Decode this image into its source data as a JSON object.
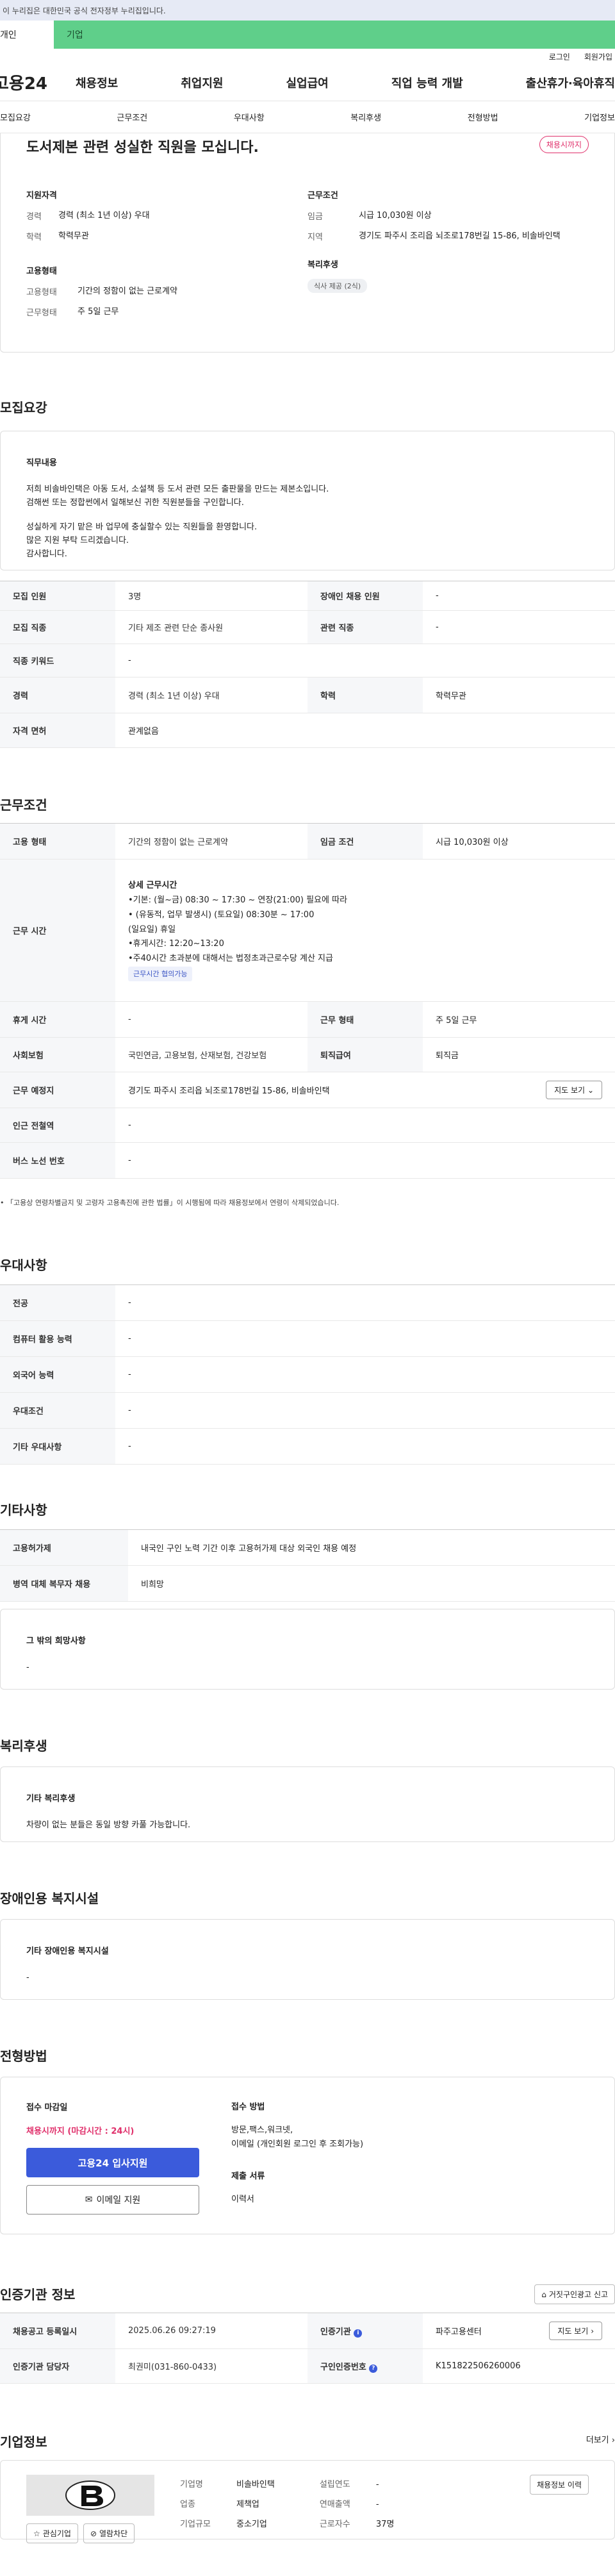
{
  "gov_banner": {
    "text": "이 누리집은 대한민국 공식 전자정부 누리집입니다."
  },
  "site_tabs": {
    "personal": "개인",
    "company": "기업"
  },
  "util": {
    "login": "로그인",
    "signup": "회원가입"
  },
  "logo": "고용24",
  "gnb": [
    "채용정보",
    "취업지원",
    "실업급여",
    "직업 능력 개발",
    "출산휴가·육아휴직"
  ],
  "anchor_nav": [
    "모집요강",
    "근무조건",
    "우대사항",
    "복리후생",
    "전형방법",
    "기업정보"
  ],
  "summary": {
    "title": "도서제본 관련 성실한 직원을 모십니다.",
    "status": "채용시까지",
    "qual_heading": "지원자격",
    "qual": [
      {
        "k": "경력",
        "v": "경력 (최소 1년 이상) 우대"
      },
      {
        "k": "학력",
        "v": "학력무관"
      }
    ],
    "emp_heading": "고용형태",
    "emp": [
      {
        "k": "고용형태",
        "v": "기간의 정함이 없는 근로계약"
      },
      {
        "k": "근무형태",
        "v": "주 5일 근무"
      }
    ],
    "cond_heading": "근무조건",
    "cond": [
      {
        "k": "임금",
        "v": "시급 10,030원 이상"
      },
      {
        "k": "지역",
        "v": "경기도 파주시 조리읍 뇌조로178번길 15-86, 비솔바인택"
      }
    ],
    "welfare_heading": "복리후생",
    "welfare_pill": "식사 제공 (2식)"
  },
  "recruit": {
    "heading": "모집요강",
    "duty_heading": "직무내용",
    "duty_lines": [
      "저희 비솔바인택은 아동 도서, 소설책 등 도서 관련 모든 출판물을 만드는 제본소입니다.",
      "검해썬 또는 정합썬에서 일해보신 귀한 직원분들을 구인합니다.",
      "",
      "성실하게 자기 맡은 바 업무에 충실할수 있는 직원들을 환영합니다.",
      "많은 지원 부탁 드리겠습니다.",
      "감사합니다."
    ],
    "rows": [
      {
        "k1": "모집 인원",
        "v1": "3명",
        "k2": "장애인 채용 인원",
        "v2": "-"
      },
      {
        "k1": "모집 직종",
        "v1": "기타 제조 관련 단순 종사원",
        "k2": "관련 직종",
        "v2": "-"
      },
      {
        "k1": "직종 키워드",
        "v1": "-"
      },
      {
        "k1": "경력",
        "v1": "경력 (최소 1년 이상) 우대",
        "k2": "학력",
        "v2": "학력무관"
      },
      {
        "k1": "자격 면허",
        "v1": "관계없음"
      }
    ]
  },
  "work": {
    "heading": "근무조건",
    "row1": {
      "k1": "고용 형태",
      "v1": "기간의 정함이 없는 근로계약",
      "k2": "임금 조건",
      "v2": "시급 10,030원 이상"
    },
    "hours_label": "근무 시간",
    "hours_title": "상세 근무시간",
    "hours_lines": [
      "•기본: (월~금) 08:30 ~ 17:30 ~ 연장(21:00) 필요에 따라",
      "• (유동적, 업무 발생시) (토요일) 08:30분 ~ 17:00",
      "(일요일) 휴일",
      "•휴게시간: 12:20~13:20",
      "•주40시간 초과분에 대해서는 법정초과근로수당 계산 지급"
    ],
    "hours_badge": "근무시간 협의가능",
    "row3": {
      "k1": "휴게 시간",
      "v1": "-",
      "k2": "근무 형태",
      "v2": "주 5일 근무"
    },
    "row4": {
      "k1": "사회보험",
      "v1": "국민연금, 고용보험, 산재보험, 건강보험",
      "k2": "퇴직급여",
      "v2": "퇴직금"
    },
    "row5": {
      "k1": "근무 예정지",
      "v1": "경기도 파주시 조리읍 뇌조로178번길 15-86, 비솔바인택",
      "btn": "지도 보기"
    },
    "row6": {
      "k1": "인근 전철역",
      "v1": "-"
    },
    "row7": {
      "k1": "버스 노선 번호",
      "v1": "-"
    },
    "note": "「고용상 연령차별금지 및 고령자 고용촉진에 관한 법률」이 시행됨에 따라 채용정보에서 연령이 삭제되었습니다."
  },
  "pref": {
    "heading": "우대사항",
    "rows": [
      {
        "k": "전공",
        "v": "-"
      },
      {
        "k": "컴퓨터 활용 능력",
        "v": "-"
      },
      {
        "k": "외국어 능력",
        "v": "-"
      },
      {
        "k": "우대조건",
        "v": "-"
      },
      {
        "k": "기타 우대사항",
        "v": "-"
      }
    ]
  },
  "etc": {
    "heading": "기타사항",
    "rows": [
      {
        "k": "고용허가제",
        "v": "내국인 구인 노력 기간 이후 고용허가제 대상 외국인 채용 예정"
      },
      {
        "k": "병역 대체 복무자 채용",
        "v": "비희망"
      }
    ],
    "other_heading": "그 밖의 희망사항",
    "other_value": "-"
  },
  "welfare": {
    "heading": "복리후생",
    "box_heading": "기타 복리후생",
    "box_text": "차량이 없는 분들은 동일 방향 카풀 가능합니다."
  },
  "disabled": {
    "heading": "장애인용 복지시설",
    "box_heading": "기타 장애인용 복지시설",
    "box_text": "-"
  },
  "selection": {
    "heading": "전형방법",
    "deadline_heading": "접수 마감일",
    "deadline": "채용시까지 (마감시간 : 24시)",
    "apply_button": "고용24 입사지원",
    "mail_button": "이메일 지원",
    "method_heading": "접수 방법",
    "method_lines": [
      "방문,팩스,워크넷,",
      "이메일 (개인회원 로그인 후 조회가능)"
    ],
    "docs_heading": "제출 서류",
    "docs": "이력서"
  },
  "agency": {
    "heading": "인증기관 정보",
    "report_button": "거짓구인광고 신고",
    "row1": {
      "k1": "채용공고 등록일시",
      "v1": "2025.06.26 09:27:19",
      "k2": "인증기관",
      "v2": "파주고용센터",
      "btn": "지도 보기"
    },
    "row2": {
      "k1": "인증기관 담당자",
      "v1": "최권미(031-860-0433)",
      "k2": "구인인증번호",
      "v2": "K151822506260006"
    }
  },
  "company": {
    "heading": "기업정보",
    "more": "더보기",
    "fav_button": "관심기업",
    "block_button": "열람차단",
    "fields": [
      {
        "k": "기업명",
        "v": "비솔바인택"
      },
      {
        "k": "업종",
        "v": "제책업"
      },
      {
        "k": "기업규모",
        "v": "중소기업"
      }
    ],
    "fields2": [
      {
        "k": "설립연도",
        "v": "-"
      },
      {
        "k": "연매출액",
        "v": "-"
      },
      {
        "k": "근로자수",
        "v": "37명"
      }
    ],
    "jobs_button": "채용정보 이력"
  }
}
